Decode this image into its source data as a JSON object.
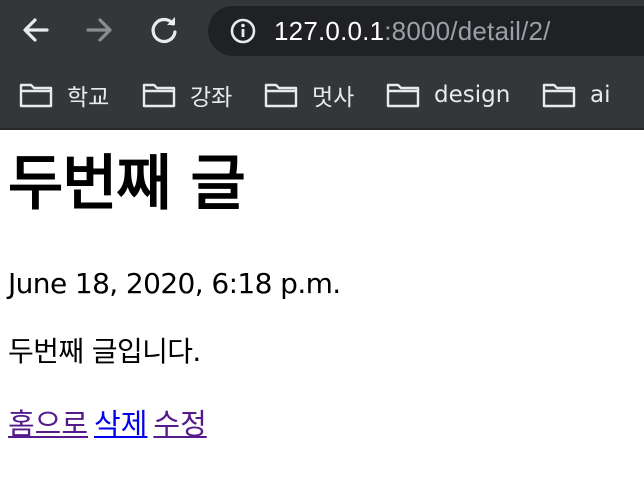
{
  "browser": {
    "url_host": "127.0.0.1",
    "url_path": ":8000/detail/2/",
    "nav_icons": [
      "back-arrow-icon",
      "forward-arrow-icon",
      "reload-icon",
      "info-icon"
    ]
  },
  "bookmarks": [
    {
      "label": "학교",
      "icon": "folder-icon"
    },
    {
      "label": "강좌",
      "icon": "folder-icon"
    },
    {
      "label": "멋사",
      "icon": "folder-icon"
    },
    {
      "label": "design",
      "icon": "folder-icon"
    },
    {
      "label": "ai",
      "icon": "folder-icon"
    }
  ],
  "post": {
    "title": "두번째 글",
    "date": "June 18, 2020, 6:18 p.m.",
    "body": "두번째 글입니다."
  },
  "links": {
    "home": "홈으로",
    "delete": "삭제",
    "edit": "수정"
  },
  "colors": {
    "chrome": "#35363a",
    "omnibox": "#202124",
    "link_visited": "#551a8b",
    "link_unvisited": "#0000ee"
  }
}
